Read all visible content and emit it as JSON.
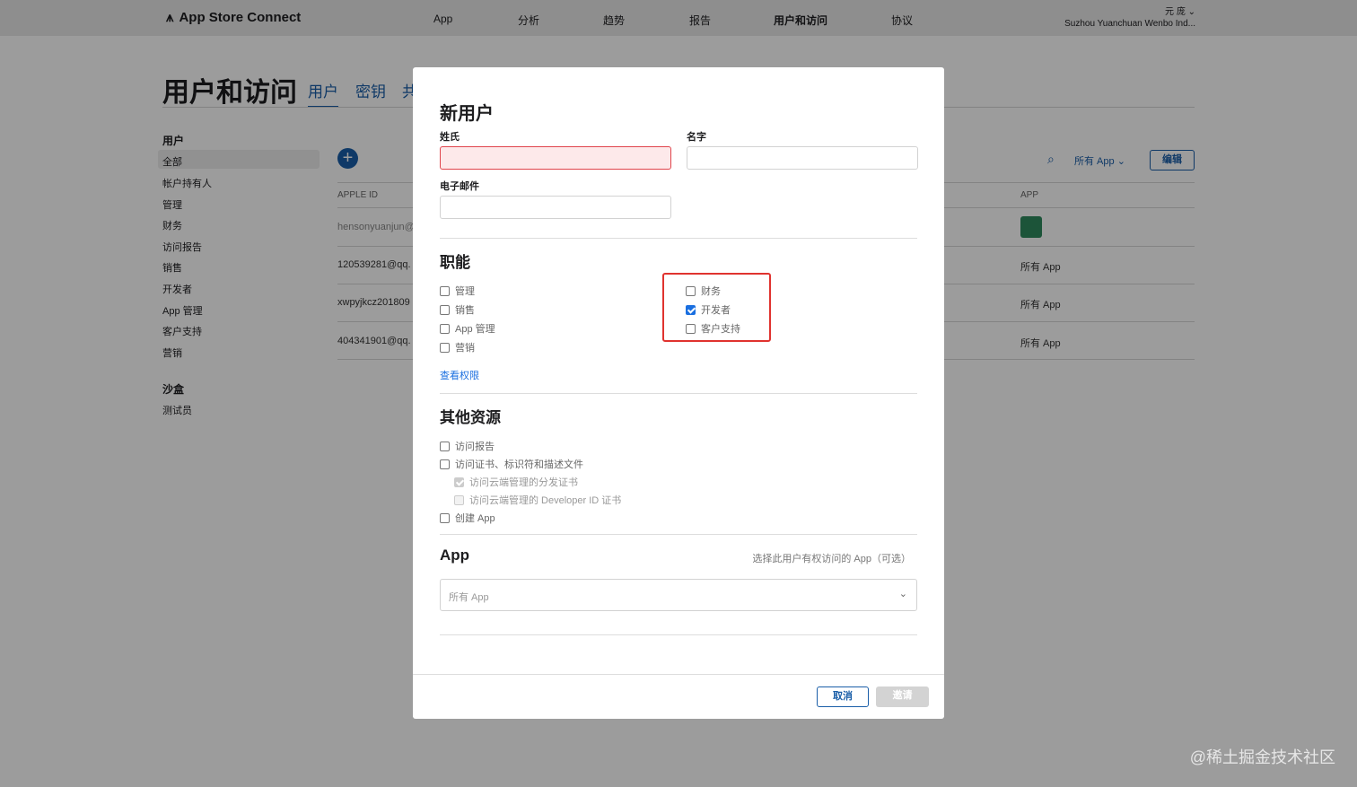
{
  "topbar": {
    "logo": "App Store Connect",
    "nav": [
      "App",
      "分析",
      "趋势",
      "报告",
      "用户和访问",
      "协议"
    ],
    "user": "元 庞",
    "org": "Suzhou Yuanchuan Wenbo Ind..."
  },
  "page": {
    "title": "用户和访问",
    "tabs": [
      "用户",
      "密钥",
      "共"
    ]
  },
  "sidebar": {
    "users_heading": "用户",
    "items": [
      "全部",
      "帐户持有人",
      "管理",
      "财务",
      "访问报告",
      "销售",
      "开发者",
      "App 管理",
      "客户支持",
      "营销"
    ],
    "sandbox_heading": "沙盒",
    "sandbox_items": [
      "测试员"
    ]
  },
  "table": {
    "filter": "所有 App",
    "edit": "编辑",
    "col_apple_id": "APPLE ID",
    "col_app": "APP",
    "rows": [
      {
        "id": "hensonyuanjun@",
        "app": ""
      },
      {
        "id": "120539281@qq.",
        "app": "所有 App"
      },
      {
        "id": "xwpyjkcz201809",
        "app": "所有 App"
      },
      {
        "id": "404341901@qq.",
        "app": "所有 App"
      }
    ]
  },
  "modal": {
    "title": "新用户",
    "last_name_label": "姓氏",
    "last_name_value": "",
    "first_name_label": "名字",
    "first_name_value": "",
    "email_label": "电子邮件",
    "email_value": "",
    "roles_title": "职能",
    "roles_left": [
      {
        "label": "管理",
        "checked": false
      },
      {
        "label": "销售",
        "checked": false
      },
      {
        "label": "App 管理",
        "checked": false
      },
      {
        "label": "营销",
        "checked": false
      }
    ],
    "roles_right": [
      {
        "label": "财务",
        "checked": false
      },
      {
        "label": "开发者",
        "checked": true
      },
      {
        "label": "客户支持",
        "checked": false
      }
    ],
    "view_permissions": "查看权限",
    "other_title": "其他资源",
    "other": [
      "访问报告",
      "访问证书、标识符和描述文件",
      "访问云端管理的分发证书",
      "访问云端管理的 Developer ID 证书",
      "创建 App"
    ],
    "app_title": "App",
    "app_hint": "选择此用户有权访问的 App（可选）",
    "app_select": "所有 App",
    "cancel": "取消",
    "invite": "邀请"
  },
  "watermark": "@稀土掘金技术社区"
}
